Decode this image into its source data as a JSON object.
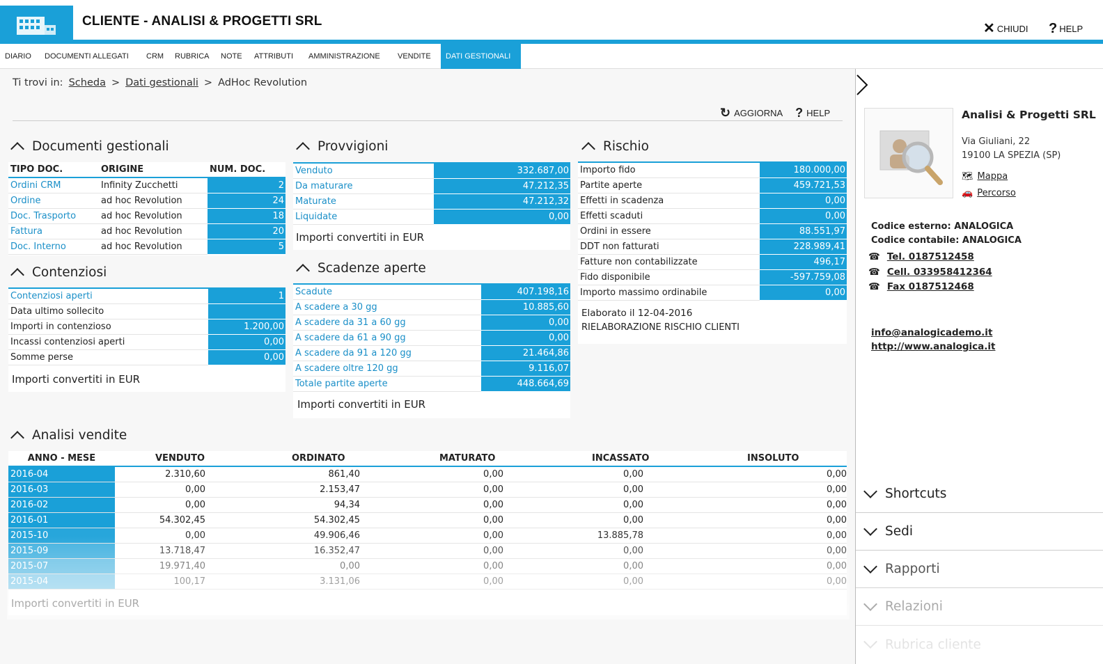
{
  "header": {
    "title": "CLIENTE - ANALISI & PROGETTI SRL",
    "close_label": "CHIUDI",
    "help_label": "HELP"
  },
  "nav": {
    "tabs": [
      "DIARIO",
      "DOCUMENTI ALLEGATI",
      "CRM",
      "RUBRICA",
      "NOTE",
      "ATTRIBUTI",
      "AMMINISTRAZIONE",
      "VENDITE",
      "DATI GESTIONALI"
    ],
    "active": "DATI GESTIONALI"
  },
  "breadcrumb": {
    "prefix": "Ti trovi in:",
    "items": [
      "Scheda",
      "Dati gestionali",
      "AdHoc Revolution"
    ],
    "separator": ">"
  },
  "toolbar": {
    "refresh_label": "AGGIORNA",
    "help_label": "HELP"
  },
  "documenti": {
    "title": "Documenti gestionali",
    "headers": [
      "TIPO DOC.",
      "ORIGINE",
      "NUM. DOC."
    ],
    "rows": [
      {
        "tipo": "Ordini CRM",
        "origine": "Infinity Zucchetti",
        "num": "2"
      },
      {
        "tipo": "Ordine",
        "origine": "ad hoc Revolution",
        "num": "24"
      },
      {
        "tipo": "Doc. Trasporto",
        "origine": "ad hoc Revolution",
        "num": "18"
      },
      {
        "tipo": "Fattura",
        "origine": "ad hoc Revolution",
        "num": "20"
      },
      {
        "tipo": "Doc. Interno",
        "origine": "ad hoc Revolution",
        "num": "5"
      }
    ]
  },
  "contenziosi": {
    "title": "Contenziosi",
    "rows": [
      {
        "label": "Contenziosi aperti",
        "value": "1",
        "link": true
      },
      {
        "label": "Data ultimo sollecito",
        "value": "",
        "link": false
      },
      {
        "label": "Importi in contenzioso",
        "value": "1.200,00",
        "link": false
      },
      {
        "label": "Incassi contenziosi aperti",
        "value": "0,00",
        "link": false
      },
      {
        "label": "Somme perse",
        "value": "0,00",
        "link": false
      }
    ],
    "note": "Importi convertiti in EUR"
  },
  "provvigioni": {
    "title": "Provvigioni",
    "rows": [
      {
        "label": "Venduto",
        "value": "332.687,00"
      },
      {
        "label": "Da maturare",
        "value": "47.212,35"
      },
      {
        "label": "Maturate",
        "value": "47.212,32"
      },
      {
        "label": "Liquidate",
        "value": "0,00"
      }
    ],
    "note": "Importi convertiti in EUR"
  },
  "scadenze": {
    "title": "Scadenze aperte",
    "rows": [
      {
        "label": "Scadute",
        "value": "407.198,16"
      },
      {
        "label": "A scadere a 30 gg",
        "value": "10.885,60"
      },
      {
        "label": "A scadere da 31 a 60 gg",
        "value": "0,00"
      },
      {
        "label": "A scadere da 61 a 90 gg",
        "value": "0,00"
      },
      {
        "label": "A scadere da 91 a 120 gg",
        "value": "21.464,86"
      },
      {
        "label": "A scadere oltre 120 gg",
        "value": "9.116,07"
      },
      {
        "label": "Totale partite aperte",
        "value": "448.664,69"
      }
    ],
    "note": "Importi convertiti in EUR"
  },
  "rischio": {
    "title": "Rischio",
    "rows": [
      {
        "label": "Importo fido",
        "value": "180.000,00"
      },
      {
        "label": "Partite aperte",
        "value": "459.721,53"
      },
      {
        "label": "Effetti in scadenza",
        "value": "0,00"
      },
      {
        "label": "Effetti scaduti",
        "value": "0,00"
      },
      {
        "label": "Ordini in essere",
        "value": "88.551,97"
      },
      {
        "label": "DDT non fatturati",
        "value": "228.989,41"
      },
      {
        "label": "Fatture non contabilizzate",
        "value": "496,17"
      },
      {
        "label": "Fido disponibile",
        "value": "-597.759,08"
      },
      {
        "label": "Importo massimo ordinabile",
        "value": "0,00"
      }
    ],
    "note1": "Elaborato il 12-04-2016",
    "note2": "RIELABORAZIONE RISCHIO CLIENTI"
  },
  "vendite": {
    "title": "Analisi vendite",
    "headers": [
      "ANNO - MESE",
      "VENDUTO",
      "ORDINATO",
      "MATURATO",
      "INCASSATO",
      "INSOLUTO"
    ],
    "rows": [
      [
        "2016-04",
        "2.310,60",
        "861,40",
        "0,00",
        "0,00",
        "0,00"
      ],
      [
        "2016-03",
        "0,00",
        "2.153,47",
        "0,00",
        "0,00",
        "0,00"
      ],
      [
        "2016-02",
        "0,00",
        "94,34",
        "0,00",
        "0,00",
        "0,00"
      ],
      [
        "2016-01",
        "54.302,45",
        "54.302,45",
        "0,00",
        "0,00",
        "0,00"
      ],
      [
        "2015-10",
        "0,00",
        "49.906,46",
        "0,00",
        "13.885,78",
        "0,00"
      ],
      [
        "2015-09",
        "13.718,47",
        "16.352,47",
        "0,00",
        "0,00",
        "0,00"
      ],
      [
        "2015-07",
        "19.971,40",
        "0,00",
        "0,00",
        "0,00",
        "0,00"
      ],
      [
        "2015-04",
        "100,17",
        "3.131,06",
        "0,00",
        "0,00",
        "0,00"
      ]
    ],
    "note": "Importi convertiti in EUR"
  },
  "contact": {
    "name": "Analisi & Progetti SRL",
    "address": "Via Giuliani, 22",
    "city": "19100 LA SPEZIA (SP)",
    "map_label": "Mappa",
    "route_label": "Percorso",
    "codice_esterno": "Codice esterno: ANALOGICA",
    "codice_contabile": "Codice contabile: ANALOGICA",
    "tel": "Tel. 0187512458",
    "cell": "Cell. 033958412364",
    "fax": "Fax 0187512468",
    "email": "info@analogicademo.it",
    "web": "http://www.analogica.it"
  },
  "side_sections": [
    "Shortcuts",
    "Sedi",
    "Rapporti",
    "Relazioni",
    "Rubrica cliente"
  ],
  "colors": {
    "accent": "#1aa0d8",
    "link": "#1a8fc8"
  }
}
